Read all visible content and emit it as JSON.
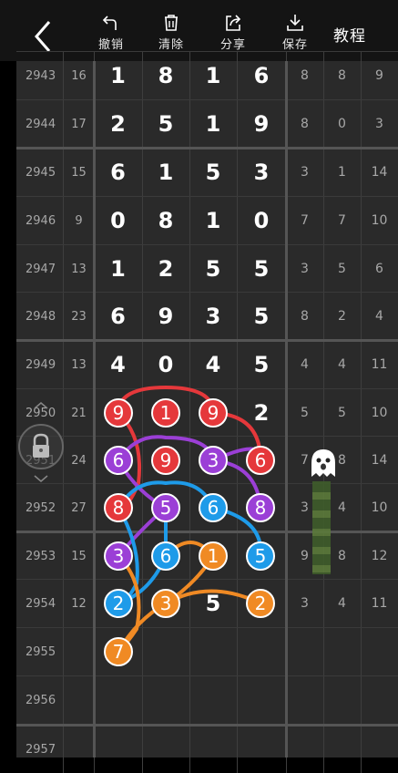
{
  "toolbar": {
    "undo_label": "撤销",
    "clear_label": "清除",
    "share_label": "分享",
    "save_label": "保存",
    "tutorial_label": "教程"
  },
  "rows": [
    {
      "issue": "2943",
      "sum": "16",
      "digits": [
        "1",
        "8",
        "1",
        "6"
      ],
      "spans": [
        "8",
        "8",
        "9"
      ]
    },
    {
      "issue": "2944",
      "sum": "17",
      "digits": [
        "2",
        "5",
        "1",
        "9"
      ],
      "spans": [
        "8",
        "0",
        "3"
      ]
    },
    {
      "issue": "2945",
      "sum": "15",
      "digits": [
        "6",
        "1",
        "5",
        "3"
      ],
      "spans": [
        "3",
        "1",
        "14"
      ]
    },
    {
      "issue": "2946",
      "sum": "9",
      "digits": [
        "0",
        "8",
        "1",
        "0"
      ],
      "spans": [
        "7",
        "7",
        "10"
      ]
    },
    {
      "issue": "2947",
      "sum": "13",
      "digits": [
        "1",
        "2",
        "5",
        "5"
      ],
      "spans": [
        "3",
        "5",
        "6"
      ]
    },
    {
      "issue": "2948",
      "sum": "23",
      "digits": [
        "6",
        "9",
        "3",
        "5"
      ],
      "spans": [
        "8",
        "2",
        "4"
      ]
    },
    {
      "issue": "2949",
      "sum": "13",
      "digits": [
        "4",
        "0",
        "4",
        "5"
      ],
      "spans": [
        "4",
        "4",
        "11"
      ]
    },
    {
      "issue": "2950",
      "sum": "21",
      "digits": [
        "9",
        "1",
        "9",
        "2"
      ],
      "spans": [
        "5",
        "5",
        "10"
      ]
    },
    {
      "issue": "2951",
      "sum": "24",
      "digits": [
        "6",
        "9",
        "3",
        "6"
      ],
      "spans": [
        "7",
        "8",
        "14"
      ]
    },
    {
      "issue": "2952",
      "sum": "27",
      "digits": [
        "8",
        "5",
        "6",
        "8"
      ],
      "spans": [
        "3",
        "4",
        "10"
      ]
    },
    {
      "issue": "2953",
      "sum": "15",
      "digits": [
        "3",
        "6",
        "1",
        "5"
      ],
      "spans": [
        "9",
        "8",
        "12"
      ]
    },
    {
      "issue": "2954",
      "sum": "12",
      "digits": [
        "2",
        "3",
        "5",
        "2"
      ],
      "spans": [
        "3",
        "4",
        "11"
      ]
    },
    {
      "issue": "2955",
      "sum": "",
      "digits": [
        "7",
        "",
        "",
        ""
      ],
      "spans": [
        "",
        "",
        ""
      ]
    },
    {
      "issue": "2956",
      "sum": "",
      "digits": [
        "",
        "",
        "",
        ""
      ],
      "spans": [
        "",
        "",
        ""
      ]
    },
    {
      "issue": "2957",
      "sum": "",
      "digits": [
        "",
        "",
        "",
        ""
      ],
      "spans": [
        "",
        "",
        ""
      ]
    }
  ],
  "colors": {
    "red": "#e5383b",
    "purple": "#9b3fd6",
    "blue": "#1e9be9",
    "orange": "#f08a24"
  }
}
